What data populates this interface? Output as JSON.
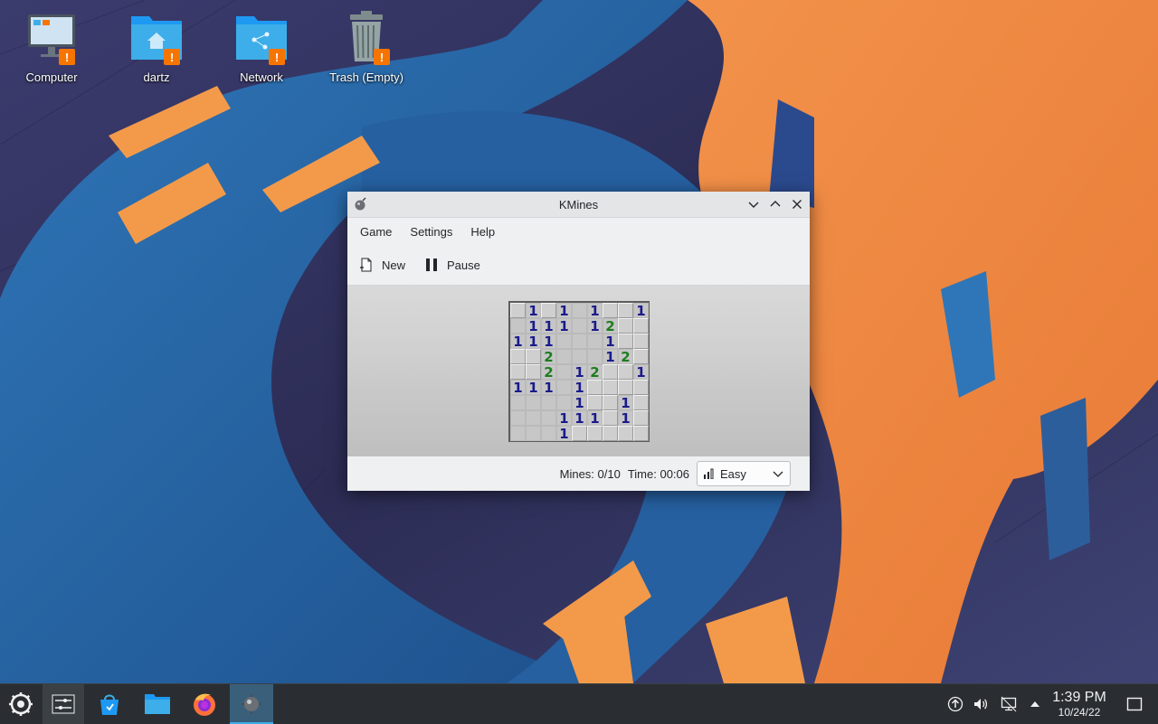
{
  "desktop": {
    "icons": [
      {
        "label": "Computer",
        "icon": "computer-icon"
      },
      {
        "label": "dartz",
        "icon": "home-folder-icon"
      },
      {
        "label": "Network",
        "icon": "network-folder-icon"
      },
      {
        "label": "Trash (Empty)",
        "icon": "trash-icon"
      }
    ],
    "badge": "!"
  },
  "window": {
    "title": "KMines",
    "menu": [
      "Game",
      "Settings",
      "Help"
    ],
    "toolbar": {
      "new_label": "New",
      "pause_label": "Pause"
    },
    "status": {
      "mines": "Mines: 0/10",
      "time": "Time: 00:06"
    },
    "difficulty": {
      "selected": "Easy"
    },
    "number_colors": {
      "1": "#1a1a8c",
      "2": "#1e7d1e"
    },
    "board": [
      "C1C1 1CC1",
      " 111 12CC",
      "111   1CC",
      "CC2   12C",
      "CC2 12CC1",
      "111 1CCCC",
      "    1CC1C",
      "   111C1C",
      "   1CCCCC"
    ]
  },
  "taskbar": {
    "clock": {
      "time": "1:39 PM",
      "date": "10/24/22"
    },
    "apps": [
      "application-launcher-icon",
      "pager-icon",
      "discover-icon",
      "files-icon",
      "firefox-icon",
      "kmines-icon"
    ],
    "tray": [
      "updates-icon",
      "volume-icon",
      "network-icon",
      "tray-expand-icon",
      "show-desktop-icon"
    ]
  }
}
